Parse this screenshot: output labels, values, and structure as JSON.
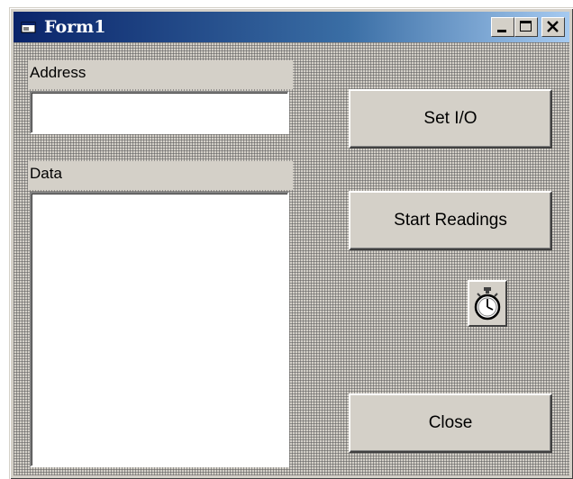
{
  "window": {
    "title": "Form1",
    "controls": [
      "minimize-icon",
      "maximize-icon",
      "close-icon"
    ]
  },
  "address": {
    "label": "Address",
    "value": "",
    "placeholder": ""
  },
  "data_field": {
    "label": "Data",
    "value": ""
  },
  "buttons": {
    "set_io": "Set I/O",
    "start_readings": "Start Readings",
    "close": "Close"
  },
  "timer": {
    "icon": "stopwatch-icon"
  }
}
